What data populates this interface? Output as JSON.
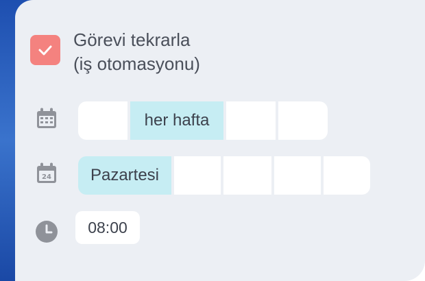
{
  "repeat_task": {
    "checked": true,
    "title_line1": "Görevi tekrarla",
    "title_line2": "(iş otomasyonu)"
  },
  "frequency": {
    "icon": "calendar-grid-icon",
    "options": [
      "",
      "her hafta",
      "",
      ""
    ],
    "selected_index": 1
  },
  "weekday": {
    "icon": "calendar-day-icon",
    "icon_text": "24",
    "options": [
      "Pazartesi",
      "",
      "",
      "",
      ""
    ],
    "selected_index": 0
  },
  "time": {
    "icon": "clock-icon",
    "value": "08:00"
  },
  "colors": {
    "accent_checkbox": "#f4827f",
    "selected_segment": "#c6edf3",
    "panel_bg": "#eceff4",
    "icon_gray": "#8f9299"
  }
}
